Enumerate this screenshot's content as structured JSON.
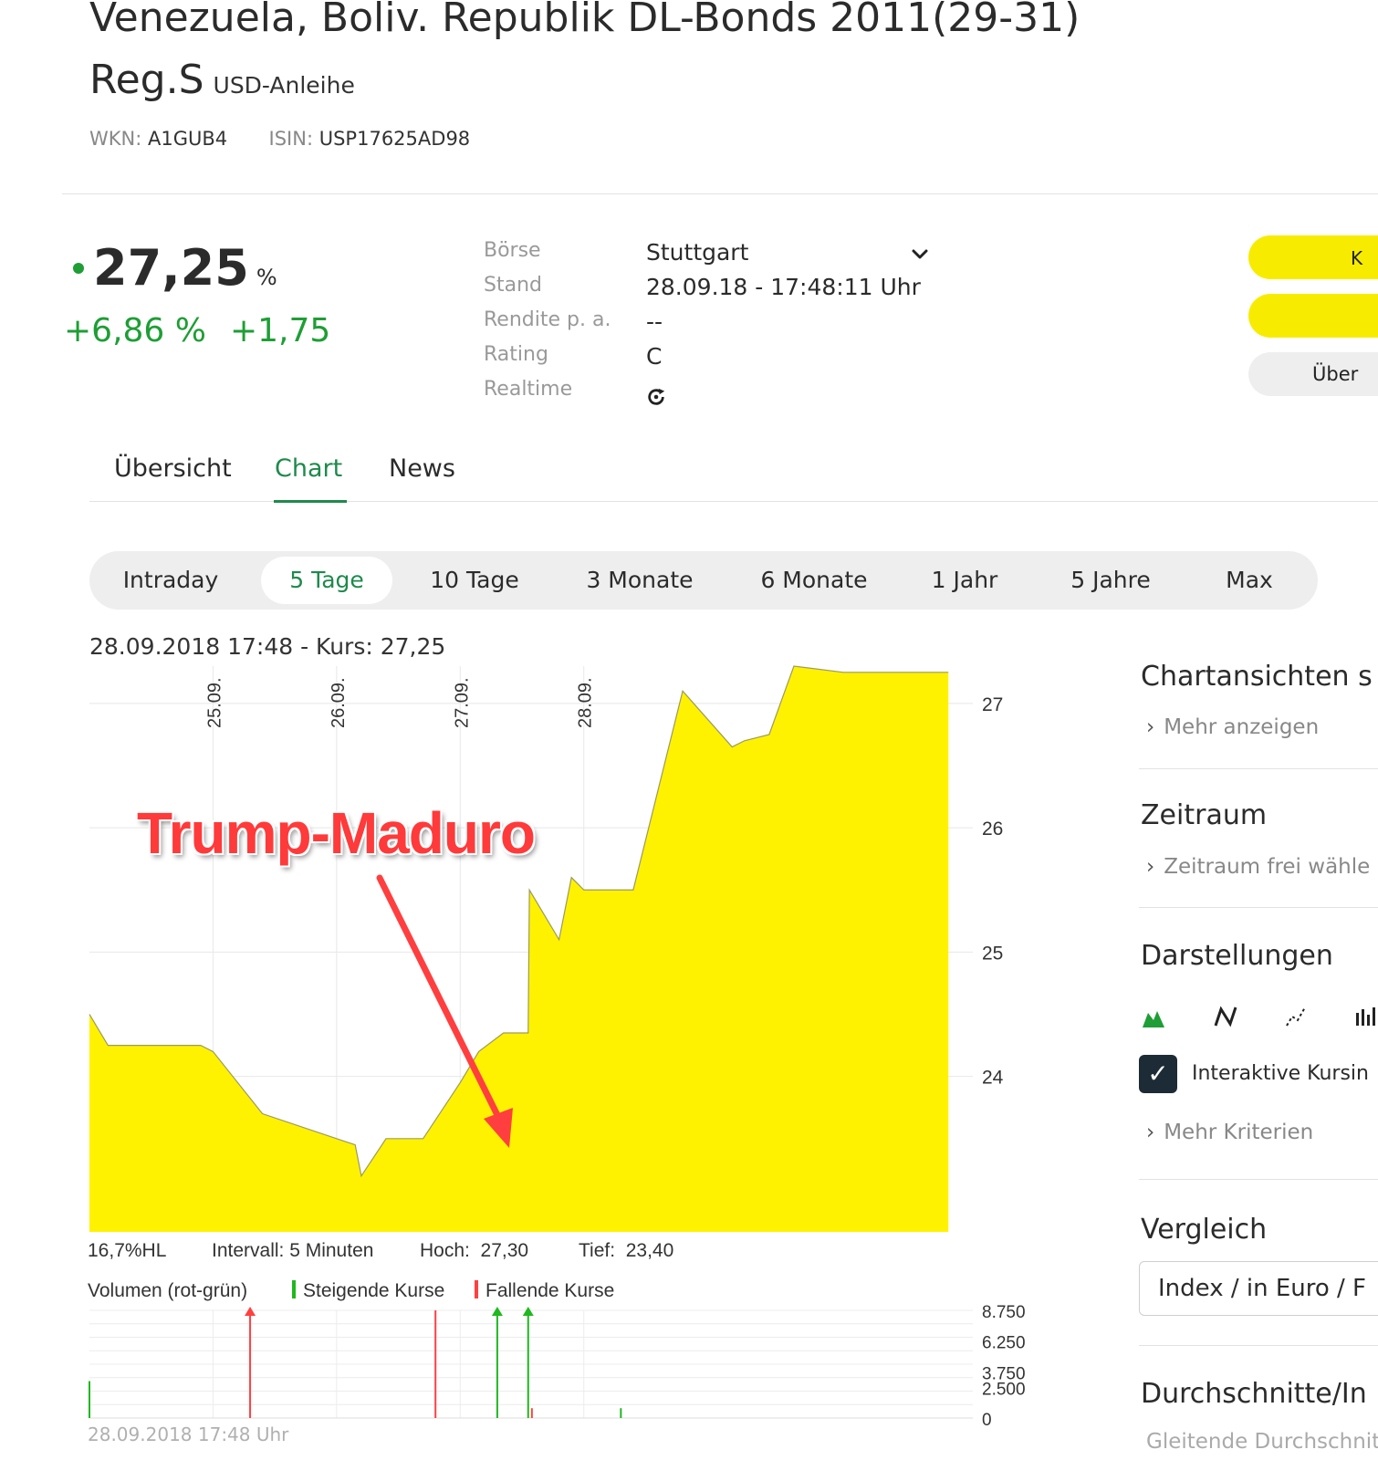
{
  "header": {
    "title_line1": "Venezuela, Boliv. Republik DL-Bonds 2011(29-31)",
    "title_line2": "Reg.S",
    "subtitle": "USD-Anleihe",
    "wkn_label": "WKN:",
    "wkn": "A1GUB4",
    "isin_label": "ISIN:",
    "isin": "USP17625AD98"
  },
  "quote": {
    "price": "27,25",
    "unit": "%",
    "change_pct": "+6,86 %",
    "change_abs": "+1,75",
    "colors": {
      "positive": "#1e9e35"
    }
  },
  "info": {
    "rows": [
      {
        "label": "Börse",
        "value": "Stuttgart"
      },
      {
        "label": "Stand",
        "value": "28.09.18 - 17:48:11 Uhr"
      },
      {
        "label": "Rendite p. a.",
        "value": "--"
      },
      {
        "label": "Rating",
        "value": "C"
      },
      {
        "label": "Realtime",
        "value": ""
      }
    ],
    "dropdown_icon": "chevron-down-icon",
    "realtime_icon": "realtime-icon"
  },
  "action_buttons": {
    "btn1_text": "K",
    "btn3_text": "Über"
  },
  "tabs": [
    {
      "label": "Übersicht"
    },
    {
      "label": "Chart",
      "active": true
    },
    {
      "label": "News"
    }
  ],
  "ranges": [
    {
      "label": "Intraday"
    },
    {
      "label": "5 Tage",
      "active": true
    },
    {
      "label": "10 Tage"
    },
    {
      "label": "3 Monate"
    },
    {
      "label": "6 Monate"
    },
    {
      "label": "1 Jahr"
    },
    {
      "label": "5 Jahre"
    },
    {
      "label": "Max"
    }
  ],
  "chart_header": "28.09.2018  17:48  - Kurs: 27,25",
  "annotation": "Trump-Maduro",
  "chart_data": [
    {
      "type": "area",
      "color": "#fff200",
      "x_labels": [
        "25.09.",
        "26.09.",
        "27.09.",
        "28.09."
      ],
      "ylim": [
        22.75,
        27.3
      ],
      "y_ticks": [
        24,
        25,
        26,
        27
      ],
      "series": [
        {
          "x": [
            0,
            0.15,
            0.9,
            1.0,
            1.4,
            2.15,
            2.2,
            2.4,
            2.7,
            3.0,
            3.15,
            3.35,
            3.5,
            3.55,
            3.56,
            3.8,
            3.9,
            4.0,
            4.05,
            4.4,
            4.8,
            5.2,
            5.3,
            5.5,
            5.7,
            6.1,
            6.2,
            6.4,
            6.7,
            6.8,
            6.95
          ],
          "y": [
            24.5,
            24.25,
            24.25,
            24.2,
            23.7,
            23.45,
            23.2,
            23.5,
            23.5,
            23.95,
            24.2,
            24.35,
            24.35,
            24.35,
            25.5,
            25.1,
            25.6,
            25.5,
            25.5,
            25.5,
            27.1,
            26.65,
            26.7,
            26.75,
            27.3,
            27.25,
            27.25,
            27.25,
            27.25,
            27.25,
            27.25
          ]
        }
      ]
    },
    {
      "type": "bar",
      "title": "Volumen (rot-grün)",
      "y_ticks": [
        "8.750",
        "6.250",
        "3.750",
        "2.500",
        "0"
      ],
      "ylim": [
        0,
        8750
      ],
      "legend": [
        {
          "name": "Steigende Kurse",
          "color": "#1fb81f"
        },
        {
          "name": "Fallende Kurse",
          "color": "#ff4040"
        }
      ],
      "bars": [
        {
          "x": 0.0,
          "value": 3000,
          "color": "#1fb81f"
        },
        {
          "x": 1.3,
          "value": 8750,
          "color": "#ff4040",
          "capped": true
        },
        {
          "x": 2.8,
          "value": 8750,
          "color": "#ff4040"
        },
        {
          "x": 3.3,
          "value": 8750,
          "color": "#1fb81f",
          "capped": true
        },
        {
          "x": 3.55,
          "value": 8750,
          "color": "#1fb81f",
          "capped": true
        },
        {
          "x": 3.58,
          "value": 800,
          "color": "#ff4040"
        },
        {
          "x": 4.3,
          "value": 800,
          "color": "#1fb81f"
        }
      ]
    }
  ],
  "chart_stats": {
    "hl": "16,7%HL",
    "interval": "Intervall: 5 Minuten",
    "high_label": "Hoch:",
    "high": "27,30",
    "low_label": "Tief:",
    "low": "23,40"
  },
  "footer_timestamp": "28.09.2018 17:48 Uhr",
  "sidebar": {
    "chartansichten": "Chartansichten s",
    "mehr_anzeigen": "Mehr anzeigen",
    "zeitraum": "Zeitraum",
    "zeitraum_link": "Zeitraum frei wähle",
    "darstellungen": "Darstellungen",
    "interaktive": "Interaktive Kursin",
    "mehr_kriterien": "Mehr Kriterien",
    "vergleich": "Vergleich",
    "select_value": "Index / in Euro / F",
    "durchschnitte": "Durchschnitte/In",
    "gleitende": "Gleitende Durchschnit"
  }
}
